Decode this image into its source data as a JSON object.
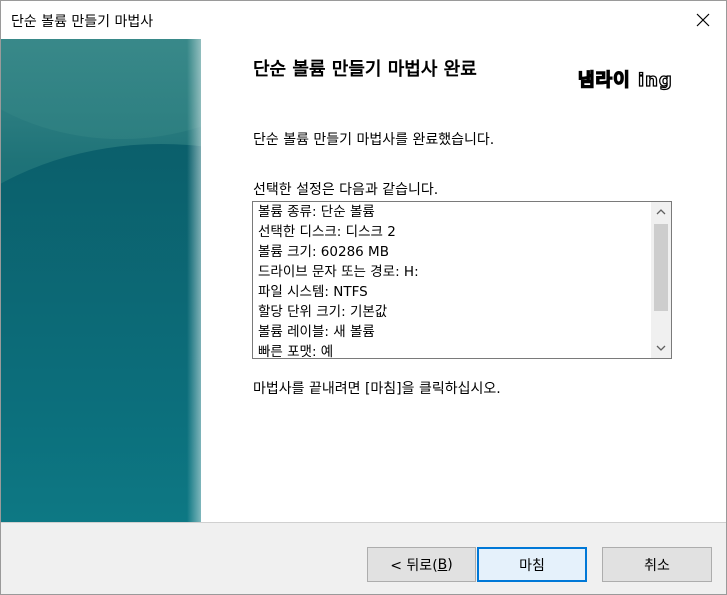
{
  "window": {
    "title": "단순 볼륨 만들기 마법사"
  },
  "content": {
    "heading": "단순 볼륨 만들기 마법사 완료",
    "watermark": "냄라이 ing",
    "completed_text": "단순 볼륨 만들기 마법사를 완료했습니다.",
    "settings_intro": "선택한 설정은 다음과 같습니다.",
    "summary_items": [
      "볼륨 종류: 단순 볼륨",
      "선택한 디스크: 디스크 2",
      "볼륨 크기: 60286 MB",
      "드라이브 문자 또는 경로: H:",
      "파일 시스템: NTFS",
      "할당 단위 크기: 기본값",
      "볼륨 레이블: 새 볼륨",
      "빠른 포맷: 예"
    ],
    "close_instruction": "마법사를 끝내려면 [마침]을 클릭하십시오."
  },
  "buttons": {
    "back_prefix": "< 뒤로(",
    "back_key": "B",
    "back_suffix": ")",
    "finish": "마침",
    "cancel": "취소"
  },
  "colors": {
    "accent": "#0078d7",
    "panel_teal": "#0e6a73"
  }
}
